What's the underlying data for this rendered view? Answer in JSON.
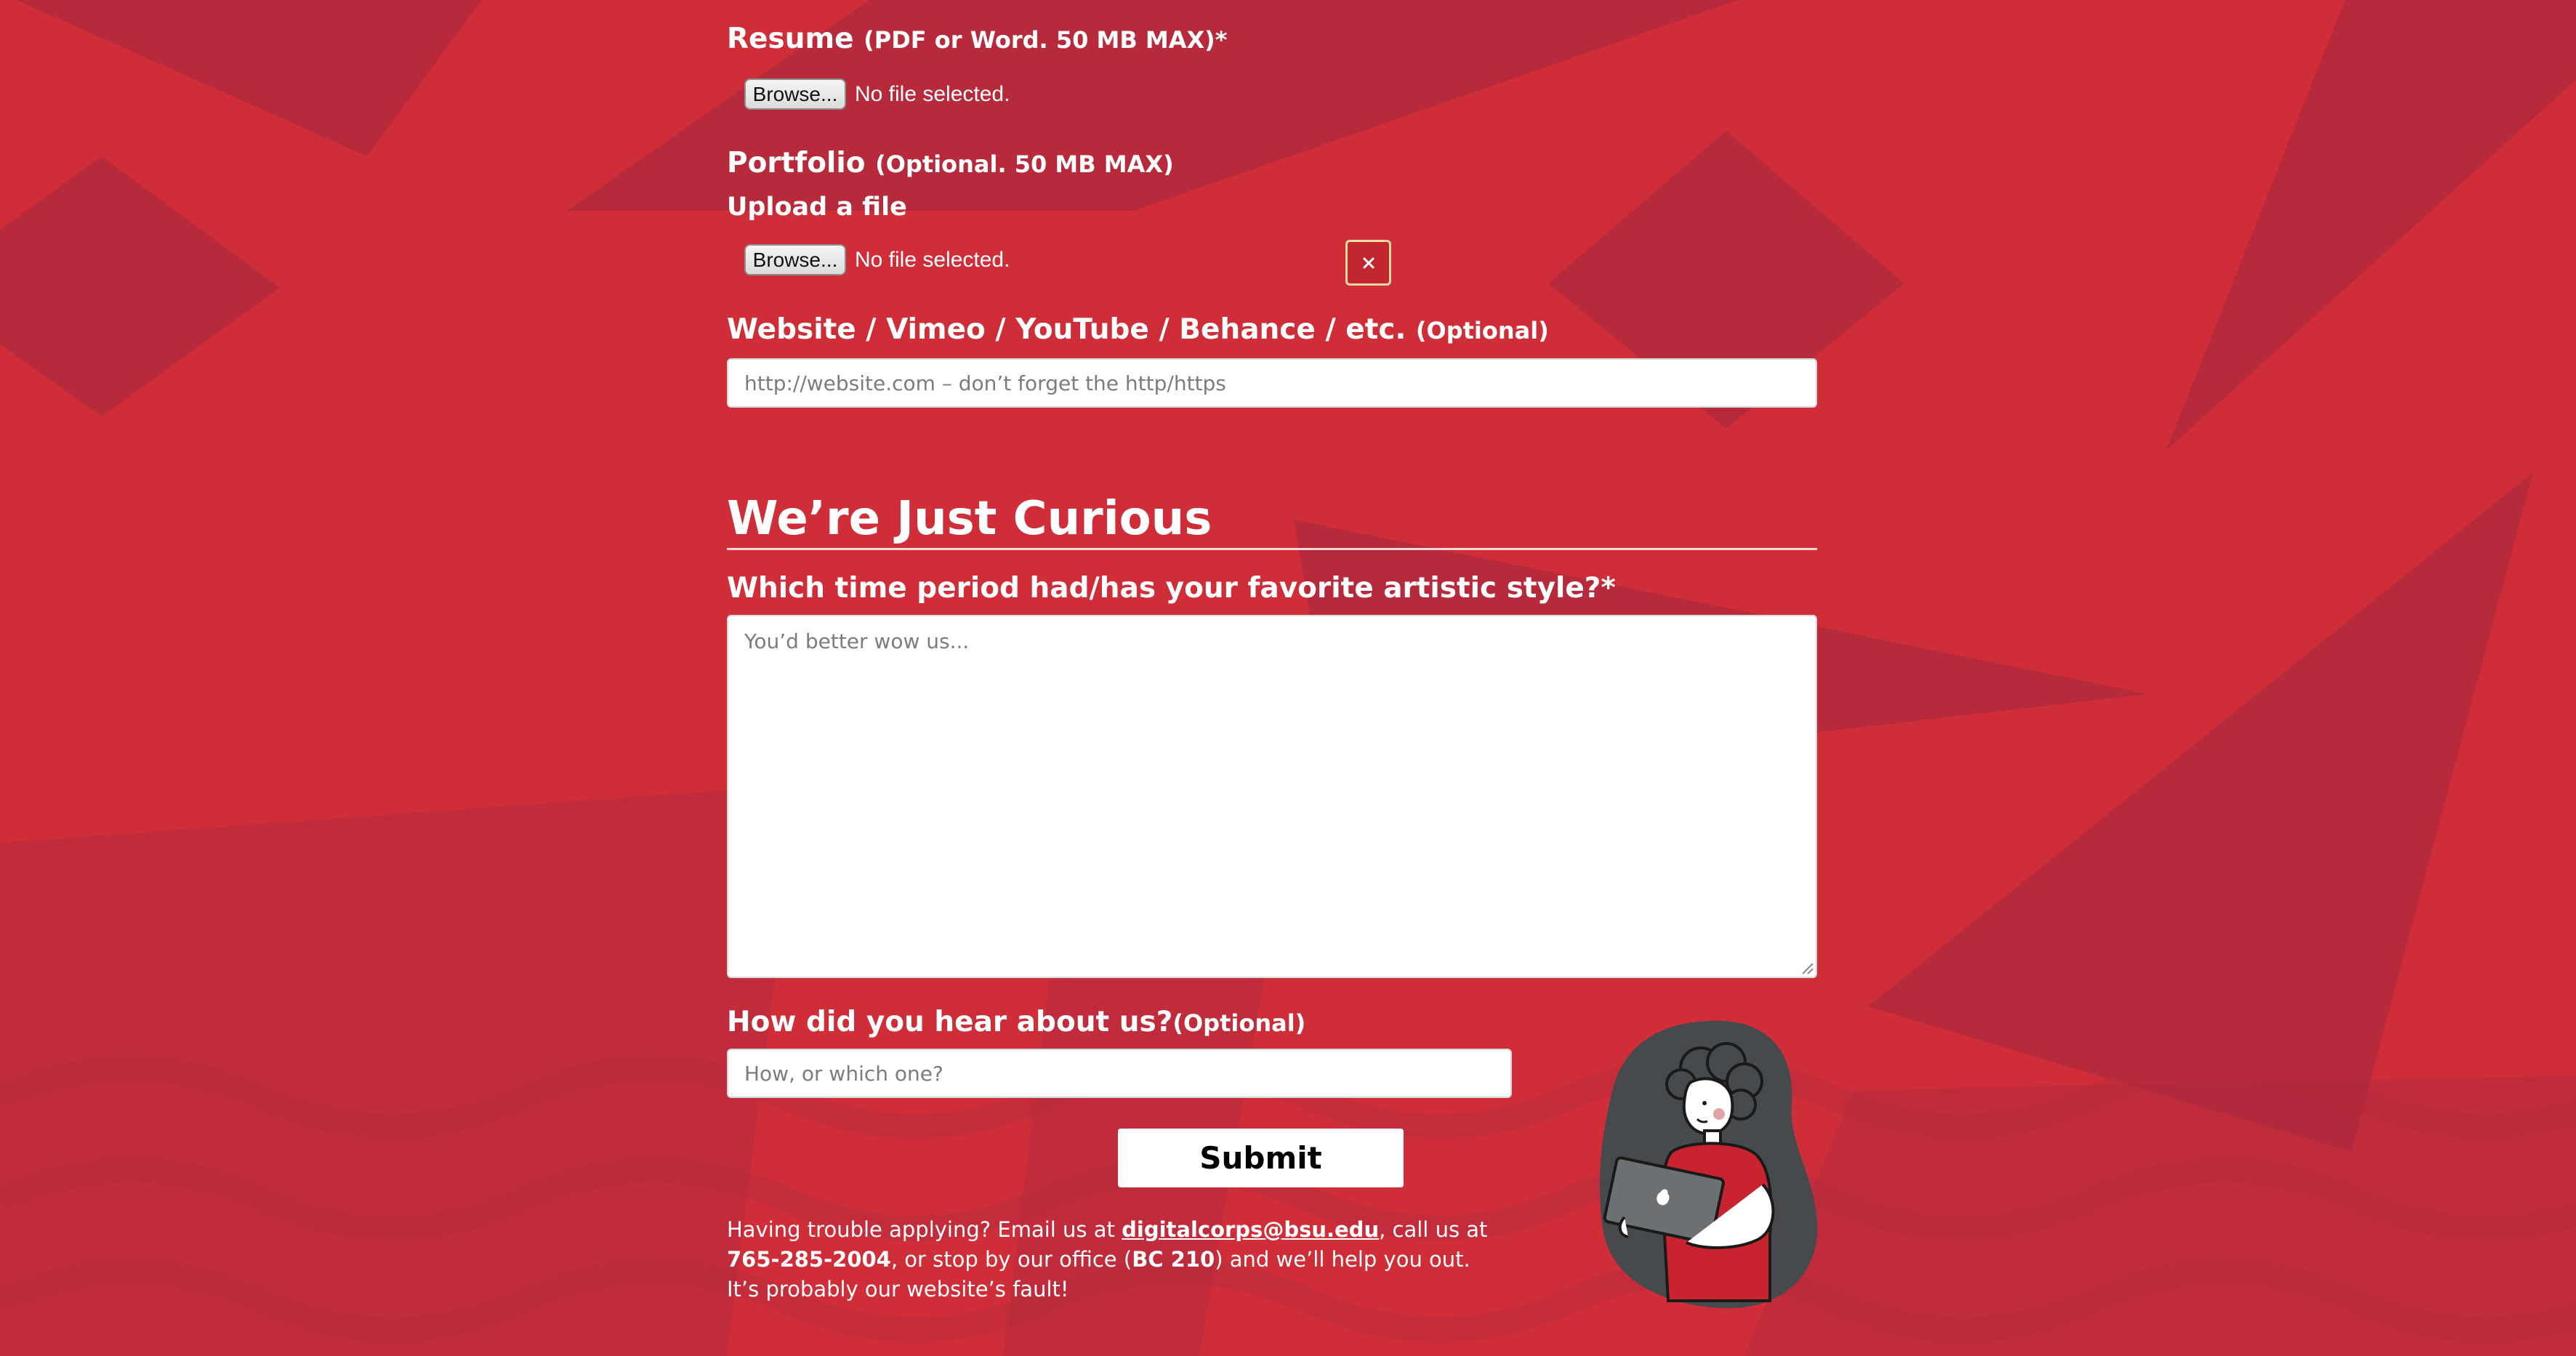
{
  "resume": {
    "label": "Resume",
    "note": "(PDF or Word. 50 MB MAX)*",
    "browse_label": "Browse...",
    "file_status": "No file selected."
  },
  "portfolio": {
    "label": "Portfolio",
    "note": "(Optional. 50 MB MAX)",
    "upload_label": "Upload a file",
    "browse_label": "Browse...",
    "file_status": "No file selected.",
    "clear_label": "×"
  },
  "website": {
    "label": "Website / Vimeo / YouTube / Behance / etc.",
    "note": "(Optional)",
    "placeholder": "http://website.com – don’t forget the http/https",
    "value": ""
  },
  "curious_section": {
    "title": "We’re Just Curious",
    "style_question": "Which time period had/has your favorite artistic style?*",
    "style_placeholder": "You’d better wow us...",
    "hear_question": "How did you hear about us?",
    "hear_note": "(Optional)",
    "hear_placeholder": "How, or which one?"
  },
  "submit": {
    "label": "Submit"
  },
  "help": {
    "part1": "Having trouble applying? Email us at ",
    "email": "digitalcorps@bsu.edu",
    "part2": ", call us at ",
    "phone": "765-285-2004",
    "part3": ", or stop by our office (",
    "office": "BC 210",
    "part4": ") and we’ll help you out. It’s probably our website’s fault!"
  },
  "colors": {
    "background": "#cf2e39",
    "background_dark": "#a82a3f",
    "text": "#ffffff",
    "illustration_blob": "#474a4c",
    "shirt": "#c8232e"
  },
  "icons": {
    "clear": "close-icon",
    "illustration": "person-with-laptop-illustration"
  }
}
